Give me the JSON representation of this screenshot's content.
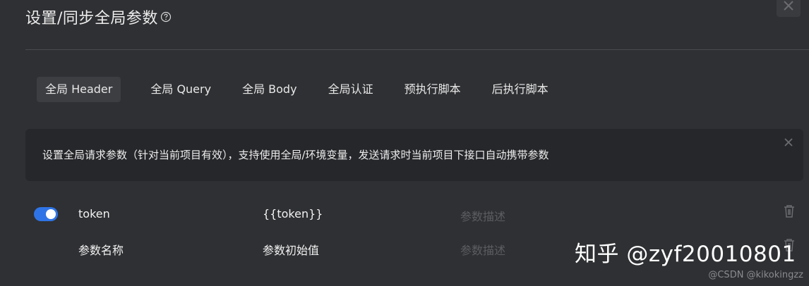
{
  "dialog": {
    "title": "设置/同步全局参数",
    "help_icon": "question-circle-icon",
    "close_icon": "close-icon"
  },
  "tabs": [
    {
      "label": "全局 Header",
      "active": true
    },
    {
      "label": "全局 Query",
      "active": false
    },
    {
      "label": "全局 Body",
      "active": false
    },
    {
      "label": "全局认证",
      "active": false
    },
    {
      "label": "预执行脚本",
      "active": false
    },
    {
      "label": "后执行脚本",
      "active": false
    }
  ],
  "notice": {
    "text": "设置全局请求参数（针对当前项目有效），支持使用全局/环境变量，发送请求时当前项目下接口自动携带参数",
    "close_icon": "close-icon"
  },
  "params": [
    {
      "enabled": true,
      "name": "token",
      "value": "{{token}}",
      "description": "",
      "description_placeholder": "参数描述"
    },
    {
      "enabled": false,
      "name": "",
      "name_placeholder": "参数名称",
      "value": "",
      "value_placeholder": "参数初始值",
      "description": "",
      "description_placeholder": "参数描述"
    }
  ],
  "watermark": "知乎 @zyf20010801",
  "footer": "@CSDN @kikokingzz",
  "colors": {
    "background": "#2f3033",
    "notice_bg": "#26272a",
    "toggle_on": "#2f74e6",
    "placeholder": "#5c5d61"
  }
}
